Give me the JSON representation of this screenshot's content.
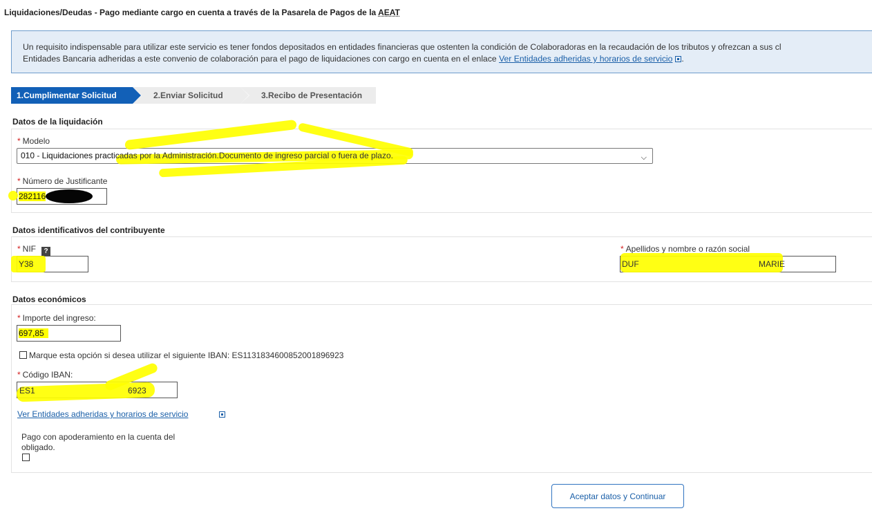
{
  "page": {
    "title_prefix": "Liquidaciones/Deudas - Pago mediante cargo en cuenta a través de la Pasarela de Pagos de la ",
    "title_abbr": "AEAT"
  },
  "info": {
    "text_line1": "Un requisito indispensable para utilizar este servicio es tener fondos depositados en entidades financieras que ostenten la condición de Colaboradoras en la recaudación de los tributos y ofrezcan a sus cl",
    "text_line2": "Entidades Bancaria adheridas a este convenio de colaboración para el pago de liquidaciones con cargo en cuenta en el enlace ",
    "link": "Ver Entidades adheridas y horarios de servicio",
    "tail": "."
  },
  "steps": [
    {
      "label": "1.Cumplimentar Solicitud",
      "active": true
    },
    {
      "label": "2.Enviar Solicitud",
      "active": false
    },
    {
      "label": "3.Recibo de Presentación",
      "active": false
    }
  ],
  "required_mark": "*",
  "liquidacion": {
    "section_title": "Datos de la liquidación",
    "modelo_label": "Modelo",
    "modelo_value": "010 - Liquidaciones practicadas por la Administración.Documento de ingreso parcial o fuera de plazo.",
    "justificante_label": "Número de Justificante",
    "justificante_value": "282116"
  },
  "contribuyente": {
    "section_title": "Datos identificativos del contribuyente",
    "nif_label": "NIF",
    "nif_help": "?",
    "nif_value": "Y38",
    "nombre_label": "Apellidos y nombre o razón social",
    "nombre_value_start": "DUF",
    "nombre_value_end": "MARIE"
  },
  "economicos": {
    "section_title": "Datos económicos",
    "importe_label": "Importe del ingreso:",
    "importe_value": "697,85",
    "iban_option_label": "Marque esta opción si desea utilizar el siguiente IBAN: ES1131834600852001896923",
    "iban_label": "Código IBAN:",
    "iban_value_start": "ES1",
    "iban_value_end": "6923",
    "entidades_link": "Ver Entidades adheridas y horarios de servicio",
    "apoderamiento_line1": "Pago con apoderamiento en la cuenta del",
    "apoderamiento_line2": "obligado."
  },
  "actions": {
    "continue_label": "Aceptar datos y Continuar"
  },
  "icons": {
    "external_link": "external-link-icon",
    "dropdown": "chevron-down-icon",
    "help": "help-icon"
  },
  "colors": {
    "step_active": "#1260b7",
    "highlight": "#ffff00",
    "link": "#1a5fa8"
  }
}
